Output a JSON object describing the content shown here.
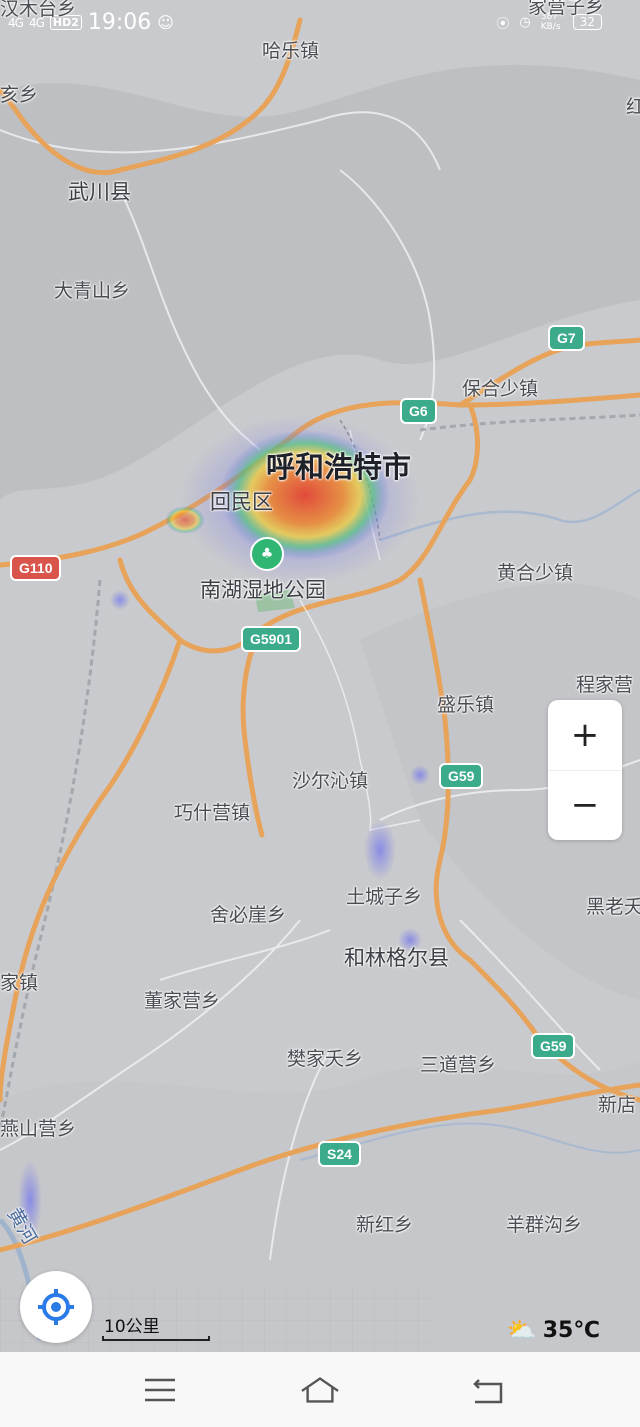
{
  "status_bar": {
    "signal_1": "4G",
    "signal_2": "4G",
    "hd_label": "HD2",
    "time": "19:06",
    "net_speed": "387 KB/s",
    "battery": "32"
  },
  "places": {
    "top_left_partial": "汉木台乡",
    "haletown": "哈乐镇",
    "haixiang": "亥乡",
    "wuchuan": "武川县",
    "daqingshan": "大青山乡",
    "hohhot": "呼和浩特市",
    "huimin": "回民区",
    "nanhu": "南湖湿地公园",
    "baohe": "保合少镇",
    "huanghe": "黄合少镇",
    "shengle": "盛乐镇",
    "chengjia": "程家营",
    "shaerqin": "沙尔沁镇",
    "qiaoshi": "巧什营镇",
    "tuchengzi": "土城子乡",
    "sheebiya": "舍必崖乡",
    "helinge": "和林格尔县",
    "heilao": "黑老夭",
    "jiazhen": "家镇",
    "dongjia": "董家营乡",
    "fanjia": "樊家夭乡",
    "sandao": "三道营乡",
    "xindian": "新店",
    "yanshan": "燕山营乡",
    "xinhong": "新红乡",
    "yangqun": "羊群沟乡",
    "river_partial": "黄河",
    "top_right_partial": "家营子乡",
    "right_edge_partial": "红"
  },
  "road_shields": {
    "g7": "G7",
    "g6": "G6",
    "g110": "G110",
    "g5901": "G5901",
    "g59_a": "G59",
    "g59_b": "G59",
    "s24": "S24"
  },
  "controls": {
    "zoom_in": "+",
    "zoom_out": "−",
    "scale_label": "10公里",
    "temperature": "35℃"
  },
  "colors": {
    "map_bg": "#c9cacd",
    "road": "#e7a35a",
    "highway_shield": "#3bab8c",
    "national_shield": "#d9544a",
    "heat_core": "#e8402a",
    "heat_mid": "#f5d33a",
    "heat_outer": "#4ec47a",
    "heat_edge": "#6b6df0"
  }
}
